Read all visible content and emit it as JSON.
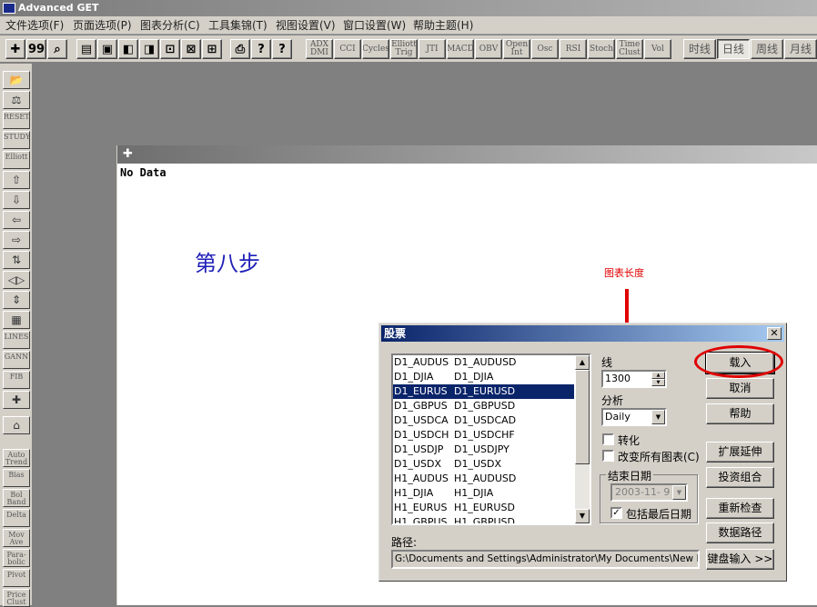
{
  "app": {
    "title": "Advanced GET"
  },
  "menu": [
    "文件选项(F)",
    "页面选项(P)",
    "图表分析(C)",
    "工具集锦(T)",
    "视图设置(V)",
    "窗口设置(W)",
    "帮助主题(H)"
  ],
  "toolbar": {
    "icons": [
      "✚",
      "99",
      "⌕",
      "▤",
      "▣",
      "◧",
      "◨",
      "⊡",
      "⊠",
      "⊞",
      "⎙",
      "?",
      "?"
    ],
    "indicators": [
      "ADX DMI",
      "CCI",
      "Cycles",
      "Elliott Trig",
      "JTI",
      "MACD",
      "OBV",
      "Open Int",
      "Osc",
      "RSI",
      "Stoch",
      "Time Clust",
      "Vol"
    ],
    "periods": [
      "时线",
      "日线",
      "周线",
      "月线"
    ],
    "active_period_index": 1
  },
  "sidebar": {
    "buttons": [
      "📂",
      "⚖",
      "RESET",
      "STUDY",
      "Elliott",
      "⇧",
      "⇩",
      "⇦",
      "⇨",
      "⇅",
      "◁▷",
      "⇕",
      "▦",
      "LINES",
      "GANN",
      "FIB",
      "✚",
      "⌂",
      "Auto Trend",
      "Bias",
      "Bol Band",
      "Delta",
      "Mov Ave",
      "Para-bolic",
      "Pivot",
      "Price Clust"
    ]
  },
  "chart_window": {
    "status": "No Data"
  },
  "annotations": {
    "step": "第八步",
    "callout": "图表长度"
  },
  "dialog": {
    "title": "股票",
    "close": "✕",
    "list": [
      [
        "D1_AUDUS",
        "D1_AUDUSD"
      ],
      [
        "D1_DJIA",
        "D1_DJIA"
      ],
      [
        "D1_EURUS",
        "D1_EURUSD"
      ],
      [
        "D1_GBPUS",
        "D1_GBPUSD"
      ],
      [
        "D1_USDCA",
        "D1_USDCAD"
      ],
      [
        "D1_USDCH",
        "D1_USDCHF"
      ],
      [
        "D1_USDJP",
        "D1_USDJPY"
      ],
      [
        "D1_USDX",
        "D1_USDX"
      ],
      [
        "H1_AUDUS",
        "H1_AUDUSD"
      ],
      [
        "H1_DJIA",
        "H1_DJIA"
      ],
      [
        "H1_EURUS",
        "H1_EURUSD"
      ],
      [
        "H1_GBPUS",
        "H1_GBPUSD"
      ]
    ],
    "selected_index": 2,
    "lines_label": "线",
    "lines_value": "1300",
    "analysis_label": "分析",
    "analysis_value": "Daily",
    "convert_label": "转化",
    "change_all_label": "改变所有图表(C)",
    "end_date_group": "结束日期",
    "end_date_value": "2003-11- 9",
    "include_last_label": "包括最后日期",
    "include_last_checked": "✓",
    "path_label": "路径:",
    "path_value": "G:\\Documents and Settings\\Administrator\\My Documents\\New Folder",
    "buttons": {
      "load": "载入",
      "cancel": "取消",
      "help": "帮助",
      "extend": "扩展延伸",
      "portfolio": "投资组合",
      "recheck": "重新检查",
      "data_path": "数据路径",
      "keyboard": "键盘输入 >>"
    }
  },
  "colors": {
    "accent_red": "#e00000",
    "step_blue": "#1f1fb8",
    "selection": "#0a246a"
  }
}
